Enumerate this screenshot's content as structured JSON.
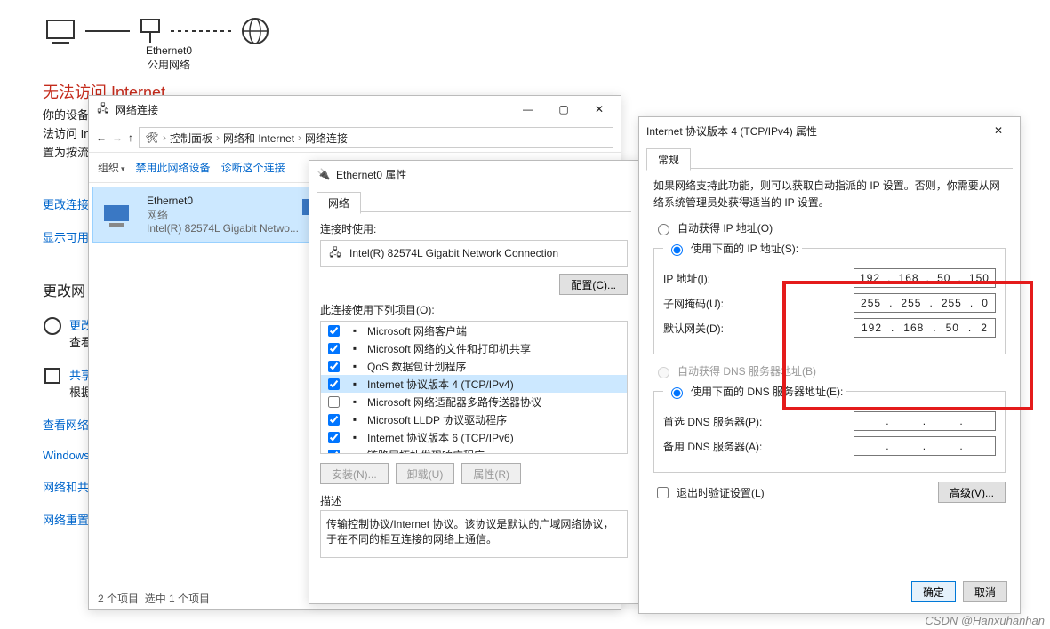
{
  "status": {
    "title": "无法访问 Internet",
    "line1": "你的设备",
    "line2": "法访问 In",
    "line3": "置为按流"
  },
  "topology": {
    "eth_name": "Ethernet0",
    "eth_net": "公用网络"
  },
  "left_links": {
    "change_conn": "更改连接",
    "show_avail": "显示可用",
    "change_net_heading": "更改网",
    "opt1_t": "更改",
    "opt1_s": "查看",
    "opt2_t": "共享",
    "opt2_s": "根据",
    "see_net": "查看网络",
    "win_fw": "Windows",
    "net_and": "网络和共",
    "net_reset": "网络重置"
  },
  "explorer": {
    "title": "网络连接",
    "breadcrumb": [
      "控制面板",
      "网络和 Internet",
      "网络连接"
    ],
    "cmd_org": "组织",
    "cmd_disable": "禁用此网络设备",
    "cmd_diag": "诊断这个连接",
    "conn_name": "Ethernet0",
    "conn_net": "网络",
    "conn_adapter": "Intel(R) 82574L Gigabit Netwo...",
    "status_left": "2 个项目",
    "status_sel": "选中 1 个项目"
  },
  "props": {
    "title": "Ethernet0 属性",
    "tab_net": "网络",
    "conn_using": "连接时使用:",
    "adapter": "Intel(R) 82574L Gigabit Network Connection",
    "btn_config": "配置(C)...",
    "uses_items": "此连接使用下列项目(O):",
    "items": [
      {
        "c": true,
        "t": "Microsoft 网络客户端"
      },
      {
        "c": true,
        "t": "Microsoft 网络的文件和打印机共享"
      },
      {
        "c": true,
        "t": "QoS 数据包计划程序"
      },
      {
        "c": true,
        "t": "Internet 协议版本 4 (TCP/IPv4)",
        "sel": true
      },
      {
        "c": false,
        "t": "Microsoft 网络适配器多路传送器协议"
      },
      {
        "c": true,
        "t": "Microsoft LLDP 协议驱动程序"
      },
      {
        "c": true,
        "t": "Internet 协议版本 6 (TCP/IPv6)"
      },
      {
        "c": true,
        "t": "链路层拓扑发现响应程序"
      }
    ],
    "btn_install": "安装(N)...",
    "btn_uninstall": "卸载(U)",
    "btn_props": "属性(R)",
    "desc_label": "描述",
    "desc_text": "传输控制协议/Internet 协议。该协议是默认的广域网络协议，于在不同的相互连接的网络上通信。"
  },
  "ipv4": {
    "title": "Internet 协议版本 4 (TCP/IPv4) 属性",
    "tab": "常规",
    "intro": "如果网络支持此功能，则可以获取自动指派的 IP 设置。否则，你需要从网络系统管理员处获得适当的 IP 设置。",
    "auto_ip": "自动获得 IP 地址(O)",
    "use_ip": "使用下面的 IP 地址(S):",
    "ip_label": "IP 地址(I):",
    "mask_label": "子网掩码(U):",
    "gw_label": "默认网关(D):",
    "ip": [
      "192",
      "168",
      "50",
      "150"
    ],
    "mask": [
      "255",
      "255",
      "255",
      "0"
    ],
    "gw": [
      "192",
      "168",
      "50",
      "2"
    ],
    "auto_dns": "自动获得 DNS 服务器地址(B)",
    "use_dns": "使用下面的 DNS 服务器地址(E):",
    "dns1_label": "首选 DNS 服务器(P):",
    "dns2_label": "备用 DNS 服务器(A):",
    "validate": "退出时验证设置(L)",
    "advanced": "高级(V)...",
    "ok": "确定",
    "cancel": "取消"
  },
  "watermark": "CSDN @Hanxuhanhan"
}
